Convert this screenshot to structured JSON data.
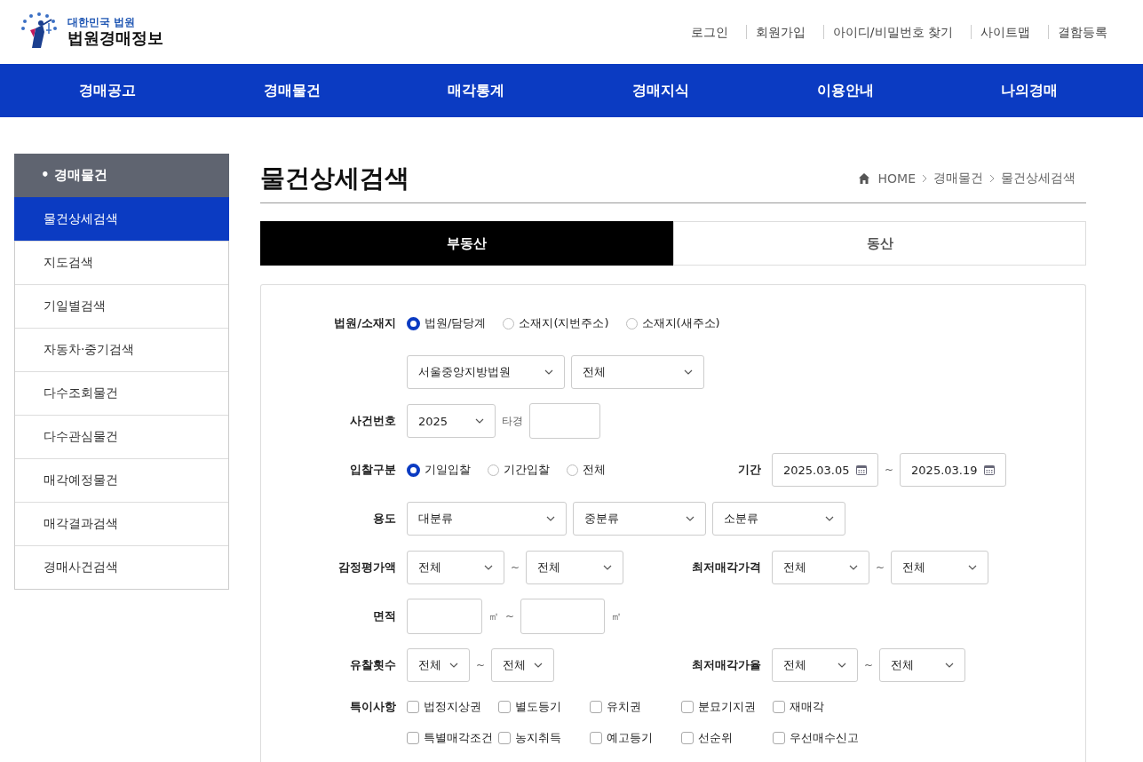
{
  "header": {
    "logo_top": "대한민국 법원",
    "logo_main": "법원경매정보",
    "links": [
      "로그인",
      "회원가입",
      "아이디/비밀번호 찾기",
      "사이트맵",
      "결함등록"
    ]
  },
  "nav": [
    "경매공고",
    "경매물건",
    "매각통계",
    "경매지식",
    "이용안내",
    "나의경매"
  ],
  "sidebar": {
    "title": "• 경매물건",
    "items": [
      {
        "label": "물건상세검색",
        "selected": true
      },
      {
        "label": "지도검색",
        "selected": false
      },
      {
        "label": "기일별검색",
        "selected": false
      },
      {
        "label": "자동차·중기검색",
        "selected": false
      },
      {
        "label": "다수조회물건",
        "selected": false
      },
      {
        "label": "다수관심물건",
        "selected": false
      },
      {
        "label": "매각예정물건",
        "selected": false
      },
      {
        "label": "매각결과검색",
        "selected": false
      },
      {
        "label": "경매사건검색",
        "selected": false
      }
    ]
  },
  "page_title": "물건상세검색",
  "breadcrumb": [
    "HOME",
    "경매물건",
    "물건상세검색"
  ],
  "tabs": [
    {
      "label": "부동산",
      "selected": true
    },
    {
      "label": "동산",
      "selected": false
    }
  ],
  "form": {
    "rows": [
      {
        "label": "법원/소재지",
        "items": [
          {
            "kind": "radio",
            "label": "법원/담당계",
            "selected": true
          },
          {
            "kind": "radio",
            "label": "소재지(지번주소)",
            "selected": false
          },
          {
            "kind": "radio",
            "label": "소재지(새주소)",
            "selected": false
          }
        ]
      },
      {
        "items": [
          {
            "kind": "select",
            "value": "서울중앙지방법원"
          },
          {
            "kind": "select",
            "value": "전체"
          }
        ]
      },
      {
        "label": "사건번호",
        "items": [
          {
            "kind": "select",
            "value": "2025"
          },
          {
            "kind": "text",
            "text": "타경"
          },
          {
            "kind": "input"
          }
        ]
      },
      {
        "label": "입찰구분",
        "items": [
          {
            "kind": "radio",
            "label": "기일입찰",
            "selected": true
          },
          {
            "kind": "radio",
            "label": "기간입찰",
            "selected": false
          },
          {
            "kind": "radio",
            "label": "전체",
            "selected": false
          }
        ],
        "right": {
          "label": "기간",
          "items": [
            {
              "kind": "date",
              "value": "2025.03.05"
            },
            {
              "kind": "text",
              "text": "~"
            },
            {
              "kind": "date",
              "value": "2025.03.19"
            }
          ]
        }
      },
      {
        "label": "용도",
        "items": [
          {
            "kind": "select",
            "value": "대분류"
          },
          {
            "kind": "select",
            "value": "중분류"
          },
          {
            "kind": "select",
            "value": "소분류"
          }
        ]
      },
      {
        "label": "감정평가액",
        "items": [
          {
            "kind": "select",
            "value": "전체"
          },
          {
            "kind": "text",
            "text": "~"
          },
          {
            "kind": "select",
            "value": "전체"
          }
        ],
        "right": {
          "label": "최저매각가격",
          "items": [
            {
              "kind": "select",
              "value": "전체"
            },
            {
              "kind": "text",
              "text": "~"
            },
            {
              "kind": "select",
              "value": "전체"
            }
          ]
        }
      },
      {
        "label": "면적",
        "items": [
          {
            "kind": "input"
          },
          {
            "kind": "text",
            "text": "㎡"
          },
          {
            "kind": "text",
            "text": "~"
          },
          {
            "kind": "input"
          },
          {
            "kind": "text",
            "text": "㎡"
          }
        ]
      },
      {
        "label": "유찰횟수",
        "items": [
          {
            "kind": "select",
            "value": "전체"
          },
          {
            "kind": "text",
            "text": "~"
          },
          {
            "kind": "select",
            "value": "전체"
          }
        ],
        "right": {
          "label": "최저매각가율",
          "items": [
            {
              "kind": "select",
              "value": "전체"
            },
            {
              "kind": "text",
              "text": "~"
            },
            {
              "kind": "select",
              "value": "전체"
            }
          ]
        }
      },
      {
        "label": "특이사항",
        "items": [
          {
            "kind": "checkbox",
            "label": "법정지상권",
            "checked": false
          },
          {
            "kind": "checkbox",
            "label": "별도등기",
            "checked": false
          },
          {
            "kind": "checkbox",
            "label": "유치권",
            "checked": false
          },
          {
            "kind": "checkbox",
            "label": "분묘기지권",
            "checked": false
          },
          {
            "kind": "checkbox",
            "label": "재매각",
            "checked": false
          },
          {
            "kind": "checkbox",
            "label": "특별매각조건",
            "checked": false
          },
          {
            "kind": "checkbox",
            "label": "농지취득",
            "checked": false
          },
          {
            "kind": "checkbox",
            "label": "예고등기",
            "checked": false
          },
          {
            "kind": "checkbox",
            "label": "선순위",
            "checked": false
          },
          {
            "kind": "checkbox",
            "label": "우선매수신고",
            "checked": false
          }
        ]
      }
    ]
  }
}
